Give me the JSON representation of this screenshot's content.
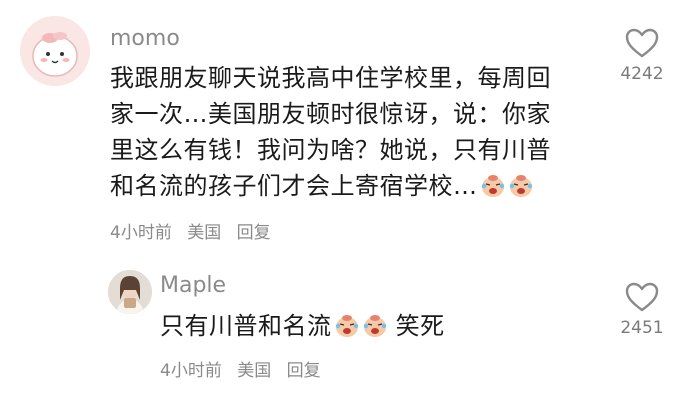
{
  "comment": {
    "username": "momo",
    "lines": [
      "我跟朋友聊天说我高中住学校里，每周回",
      "家一次…美国朋友顿时很惊讶，说：你家",
      "里这么有钱！我问为啥？她说，只有川普",
      "和名流的孩子们才会上寄宿学校…"
    ],
    "time": "4小时前",
    "location": "美国",
    "reply_label": "回复",
    "like_count": "4242",
    "emoji_icon": "laugh-cry-emoji"
  },
  "reply": {
    "username": "Maple",
    "text_before": "只有川普和名流",
    "text_after": "笑死",
    "time": "4小时前",
    "location": "美国",
    "reply_label": "回复",
    "like_count": "2451"
  },
  "colors": {
    "username": "#8a8a8a",
    "body_text": "#1a1a1a",
    "meta": "#8a8a8a",
    "heart_stroke": "#8a8a8a"
  }
}
